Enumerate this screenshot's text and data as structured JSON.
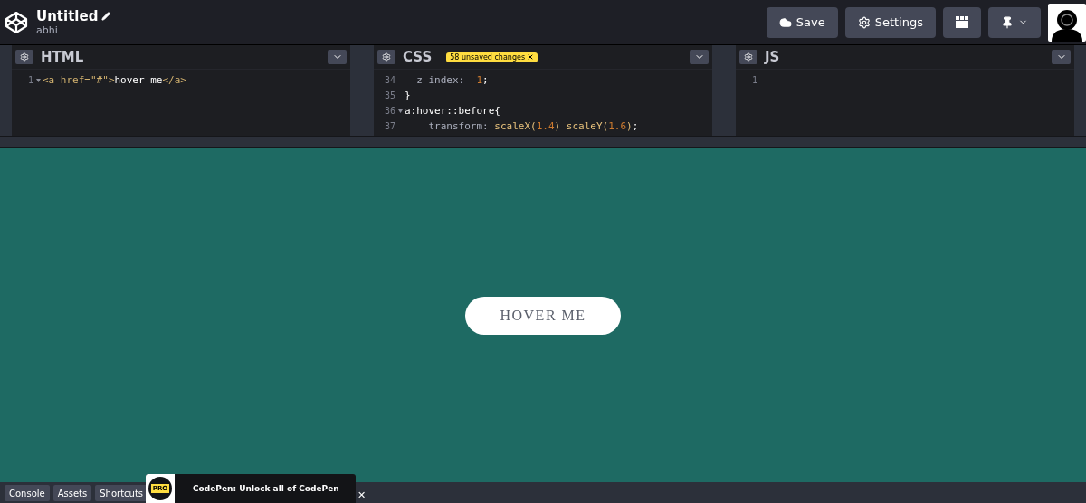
{
  "header": {
    "title": "Untitled",
    "author": "abhi",
    "buttons": [
      {
        "kind": "save",
        "label": "Save"
      },
      {
        "kind": "settings",
        "label": "Settings"
      },
      {
        "kind": "layout"
      },
      {
        "kind": "pin"
      }
    ]
  },
  "editors": [
    {
      "title": "HTML",
      "lines": [
        {
          "number": "1",
          "foldable": true,
          "tokens": [
            {
              "kind": "tag",
              "text": "<a"
            },
            {
              "kind": "attr",
              "text": " href="
            },
            {
              "kind": "string",
              "text": "\"#\""
            },
            {
              "kind": "tag",
              "text": ">"
            },
            {
              "kind": "plain",
              "text": "hover me"
            },
            {
              "kind": "tag",
              "text": "</a>"
            }
          ]
        }
      ]
    },
    {
      "title": "CSS",
      "badge": "58 unsaved changes",
      "lines": [
        {
          "number": "34",
          "foldable": false,
          "tokens": [
            {
              "kind": "prop",
              "text": "  z-index: "
            },
            {
              "kind": "number",
              "text": "-1"
            },
            {
              "kind": "plain",
              "text": ";"
            }
          ]
        },
        {
          "number": "35",
          "foldable": false,
          "tokens": [
            {
              "kind": "plain",
              "text": "}"
            }
          ]
        },
        {
          "number": "36",
          "foldable": true,
          "tokens": [
            {
              "kind": "plain",
              "text": "a:hover::before{"
            }
          ]
        },
        {
          "number": "37",
          "foldable": false,
          "tokens": [
            {
              "kind": "prop",
              "text": "    transform: "
            },
            {
              "kind": "func",
              "text": "scaleX("
            },
            {
              "kind": "number",
              "text": "1.4"
            },
            {
              "kind": "func",
              "text": ") scaleY("
            },
            {
              "kind": "number",
              "text": "1.6"
            },
            {
              "kind": "func",
              "text": ")"
            },
            {
              "kind": "plain",
              "text": ";"
            }
          ]
        }
      ]
    },
    {
      "title": "JS",
      "lines": [
        {
          "number": "1",
          "foldable": false
        }
      ]
    }
  ],
  "preview": {
    "button": "HOVER ME"
  },
  "footer": {
    "tabs": [
      "Console",
      "Assets",
      "Shortcuts"
    ],
    "promo": {
      "badge": "PRO",
      "text": "CodePen: Unlock all of CodePen",
      "close": "✕"
    }
  }
}
